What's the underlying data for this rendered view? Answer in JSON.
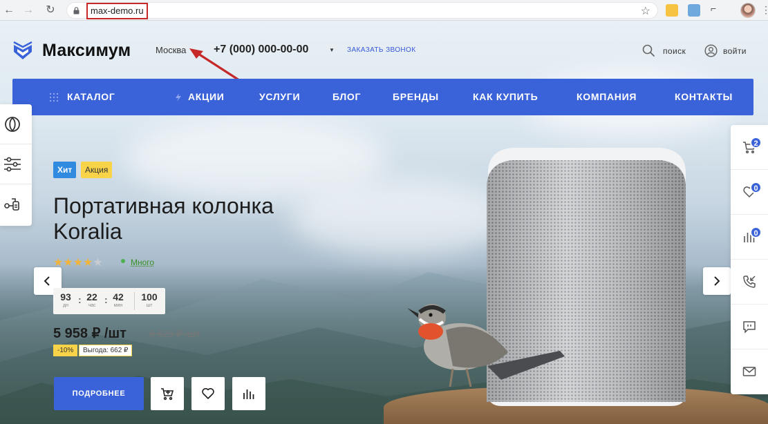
{
  "browser": {
    "url": "max-demo.ru"
  },
  "header": {
    "logo_text": "Максимум",
    "city": "Москва",
    "phone": "+7 (000) 000-00-00",
    "callback": "ЗАКАЗАТЬ ЗВОНОК",
    "search_label": "поиск",
    "login_label": "войти"
  },
  "nav": {
    "items": [
      "КАТАЛОГ",
      "АКЦИИ",
      "УСЛУГИ",
      "БЛОГ",
      "БРЕНДЫ",
      "КАК КУПИТЬ",
      "КОМПАНИЯ",
      "КОНТАКТЫ"
    ]
  },
  "product": {
    "badges": [
      "Хит",
      "Акция"
    ],
    "title_line1": "Портативная колонка",
    "title_line2": "Koralia",
    "rating": 4,
    "rating_max": 5,
    "stock": "Много",
    "timer": {
      "days": "93",
      "days_label": "дн",
      "hours": "22",
      "hours_label": "час",
      "minutes": "42",
      "minutes_label": "мин",
      "qty": "100",
      "qty_label": "шт"
    },
    "price": "5 958 ₽ /шт",
    "old_price": "6 620 ₽ /шт",
    "discount": "-10%",
    "savings": "Выгода: 662 ₽",
    "more_button": "ПОДРОБНЕЕ"
  },
  "right_panel": {
    "cart_count": "2",
    "favorites_count": "0",
    "compare_count": "0"
  },
  "colors": {
    "accent": "#3b63d9",
    "badge_hit": "#2f8ae0",
    "badge_sale": "#f9d449",
    "annotation": "#c62828"
  }
}
